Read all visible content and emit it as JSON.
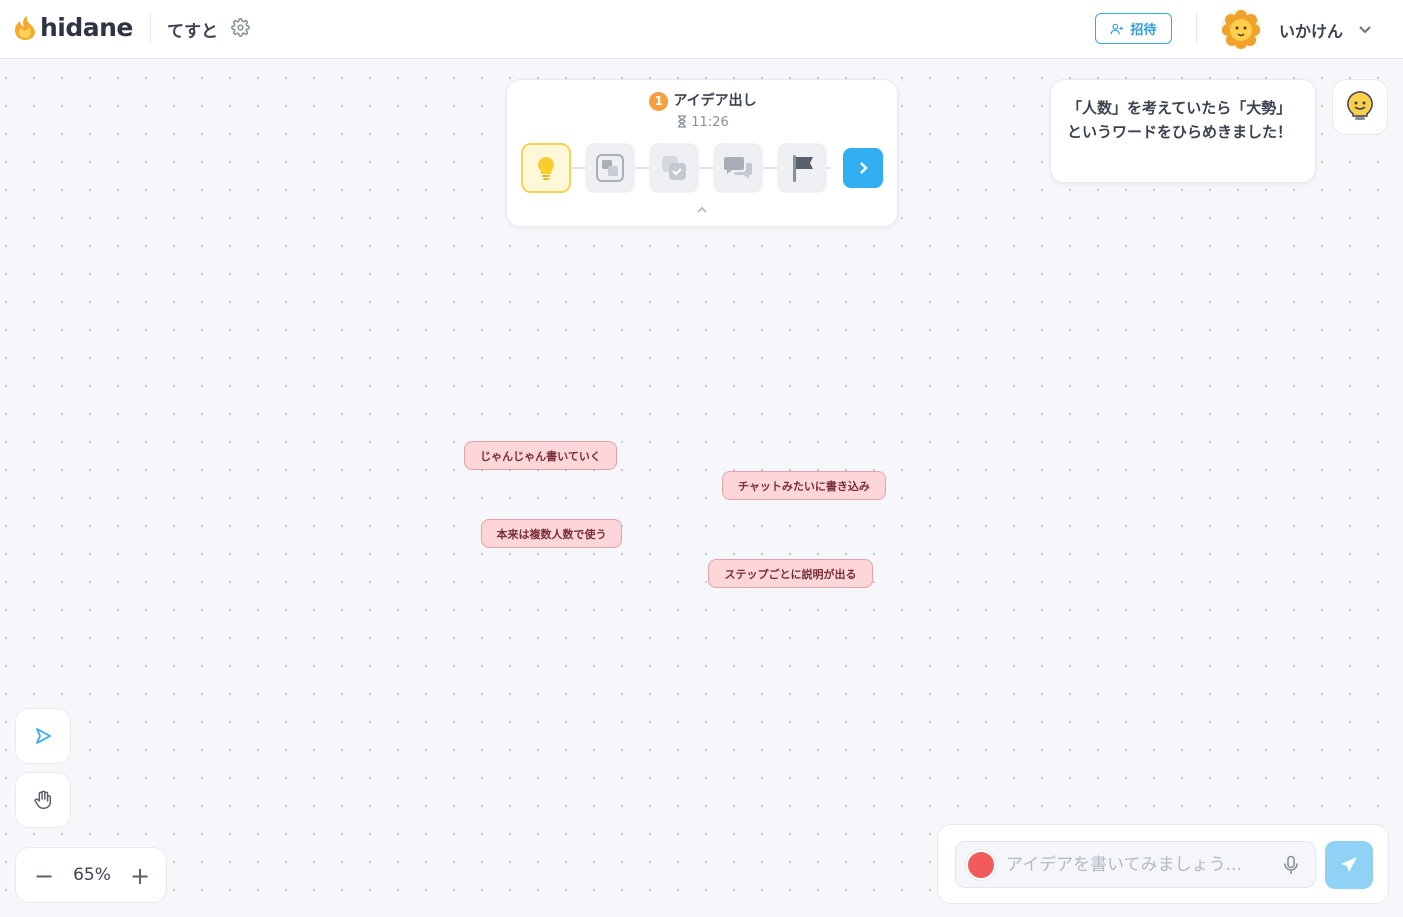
{
  "header": {
    "logo_text": "hidane",
    "room_name": "てすと",
    "invite_label": "招待",
    "user_name": "いかけん"
  },
  "steps_panel": {
    "step_number": "1",
    "step_title": "アイデア出し",
    "timer": "11:26",
    "steps": [
      {
        "icon": "lightbulb-icon",
        "active": true
      },
      {
        "icon": "group-cards-icon",
        "active": false
      },
      {
        "icon": "vote-check-icon",
        "active": false
      },
      {
        "icon": "discussion-icon",
        "active": false
      },
      {
        "icon": "flag-icon",
        "active": false
      }
    ]
  },
  "hint": {
    "text": "「人数」を考えていたら「大勢」というワードをひらめきました！"
  },
  "notes": [
    {
      "text": "じゃんじゃん書いていく"
    },
    {
      "text": "チャットみたいに書き込み"
    },
    {
      "text": "本来は複数人数で使う"
    },
    {
      "text": "ステップごとに説明が出る"
    }
  ],
  "zoom": {
    "level": "65%",
    "minus": "−",
    "plus": "+"
  },
  "input": {
    "placeholder": "アイデアを書いてみましょう...",
    "note_color": "#f25b5b"
  },
  "colors": {
    "accent": "#33aef0",
    "note_bg": "#fcd6d8",
    "active_step": "#f5d451"
  }
}
